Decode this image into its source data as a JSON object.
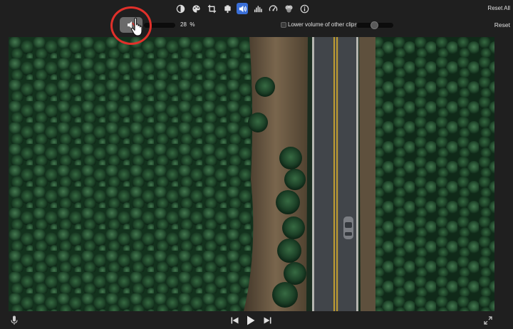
{
  "toolbar": {
    "tools": [
      {
        "name": "color-balance-icon"
      },
      {
        "name": "color-correction-icon"
      },
      {
        "name": "crop-icon"
      },
      {
        "name": "stabilization-icon"
      },
      {
        "name": "volume-icon",
        "active": true
      },
      {
        "name": "noise-reduction-icon"
      },
      {
        "name": "speed-icon"
      },
      {
        "name": "clip-filter-icon"
      },
      {
        "name": "info-icon"
      }
    ],
    "reset_all_label": "Reset All",
    "active_color": "#3a6fd8"
  },
  "volume": {
    "percent_value": "28",
    "percent_unit": "%",
    "lower_volume_label": "Lower volume of other clips:",
    "lower_volume_checked": false,
    "reset_label": "Reset"
  },
  "annotation": {
    "ring_color": "#e0302a"
  },
  "viewer": {
    "content": "aerial-forest-road-video"
  },
  "transport": {
    "icons": [
      "microphone-icon",
      "skip-back-icon",
      "play-icon",
      "skip-forward-icon",
      "fullscreen-icon"
    ]
  }
}
